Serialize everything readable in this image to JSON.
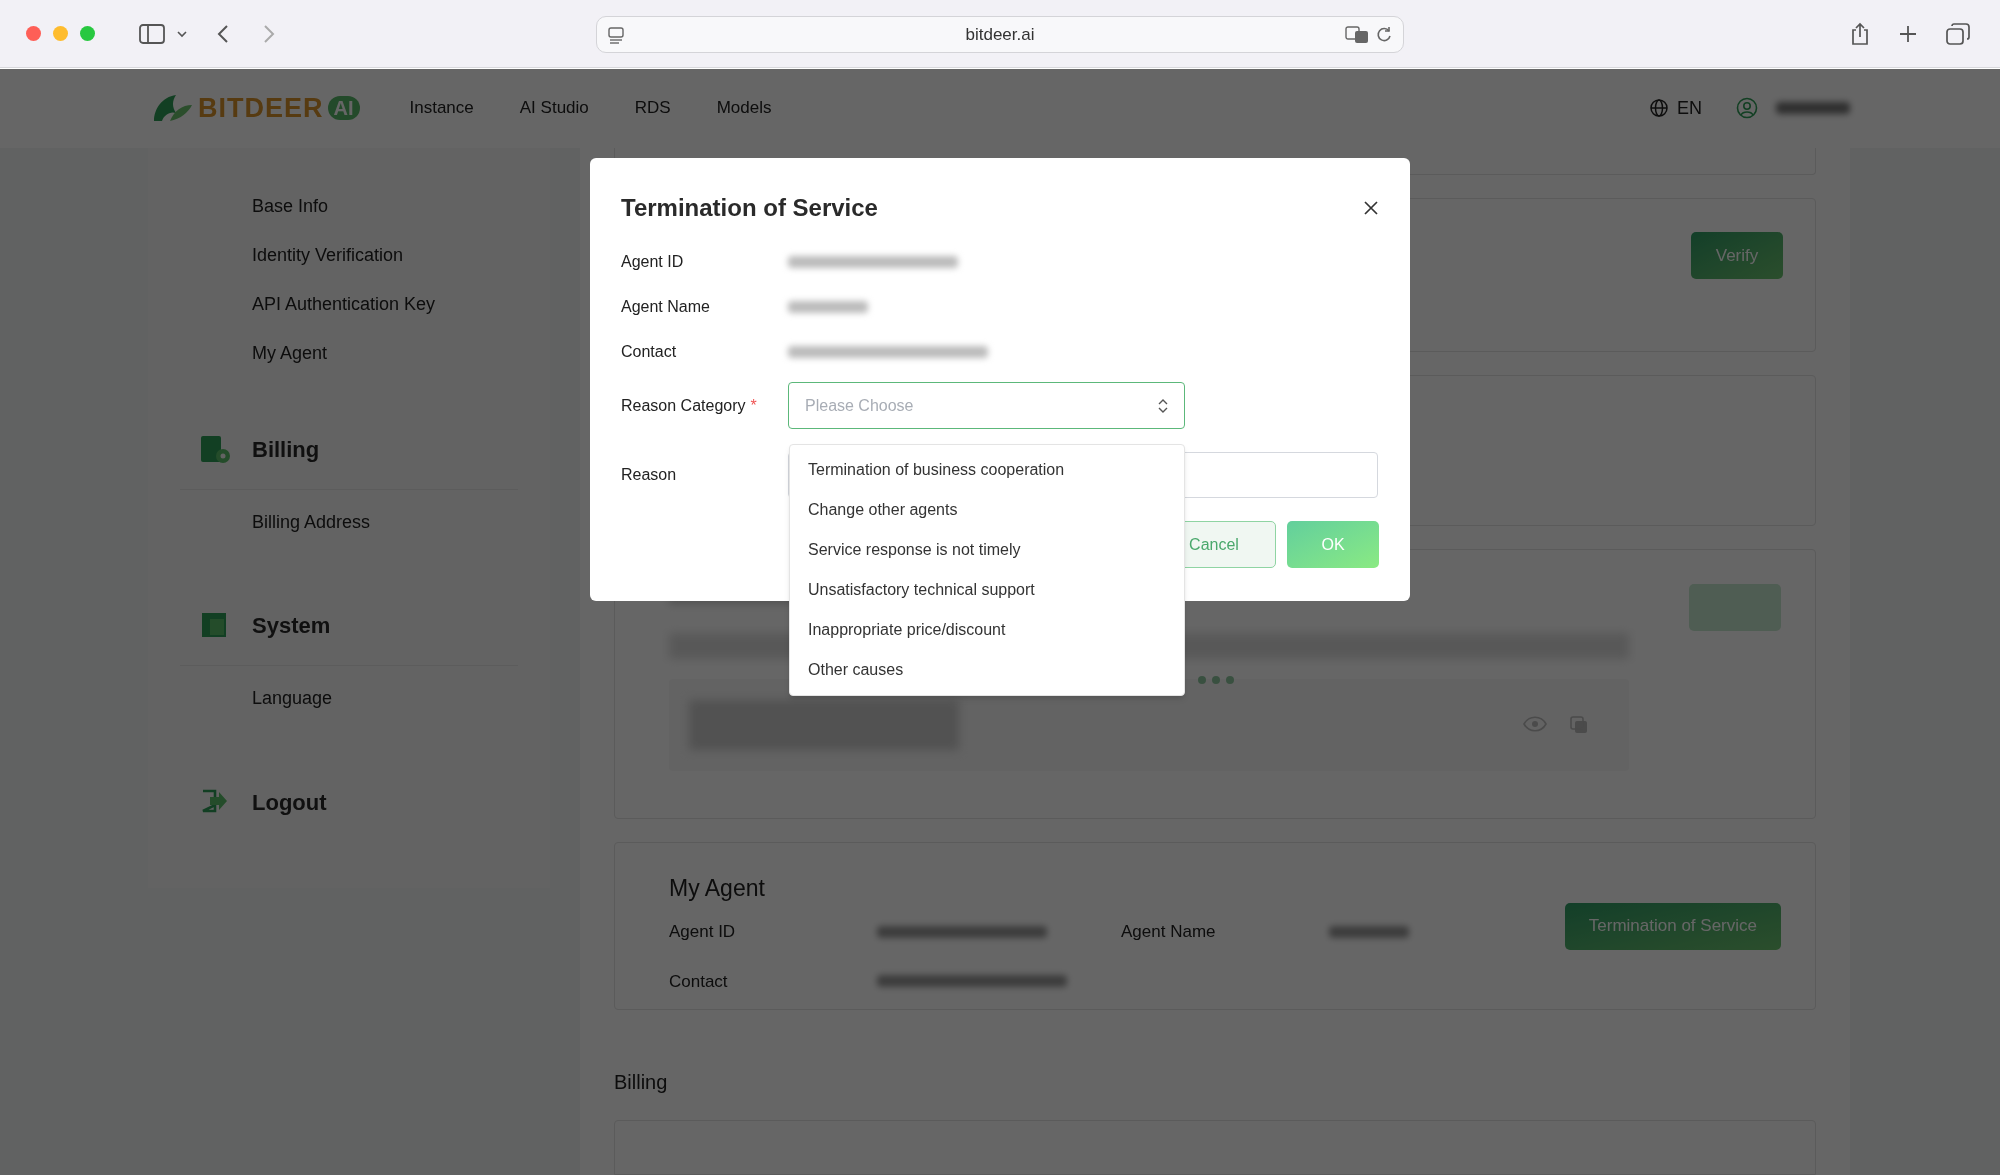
{
  "browser": {
    "url": "bitdeer.ai"
  },
  "header": {
    "logo": {
      "wordmark": "BITDEER",
      "badge": "AI"
    },
    "nav": [
      "Instance",
      "AI Studio",
      "RDS",
      "Models"
    ],
    "language": "EN"
  },
  "sidebar": {
    "sections": [
      {
        "kind": "account",
        "items": [
          "Base Info",
          "Identity Verification",
          "API Authentication Key",
          "My Agent"
        ]
      },
      {
        "kind": "billing",
        "title": "Billing",
        "items": [
          "Billing Address"
        ]
      },
      {
        "kind": "system",
        "title": "System",
        "items": [
          "Language"
        ]
      },
      {
        "kind": "logout",
        "title": "Logout"
      }
    ]
  },
  "main": {
    "verify_button": "Verify",
    "my_agent": {
      "title": "My Agent",
      "fields": [
        {
          "label": "Agent ID"
        },
        {
          "label": "Agent Name"
        },
        {
          "label": "Contact"
        }
      ],
      "button": "Termination of Service"
    },
    "billing_heading": "Billing"
  },
  "modal": {
    "title": "Termination of Service",
    "fields": [
      {
        "label": "Agent ID"
      },
      {
        "label": "Agent Name"
      },
      {
        "label": "Contact"
      }
    ],
    "reason_category": {
      "label": "Reason Category",
      "required_mark": "*",
      "placeholder": "Please Choose",
      "expanded": true,
      "options": [
        "Termination of business cooperation",
        "Change other agents",
        "Service response is not timely",
        "Unsatisfactory technical support",
        "Inappropriate price/discount",
        "Other causes"
      ]
    },
    "reason": {
      "label": "Reason"
    },
    "buttons": {
      "cancel": "Cancel",
      "ok": "OK"
    }
  }
}
